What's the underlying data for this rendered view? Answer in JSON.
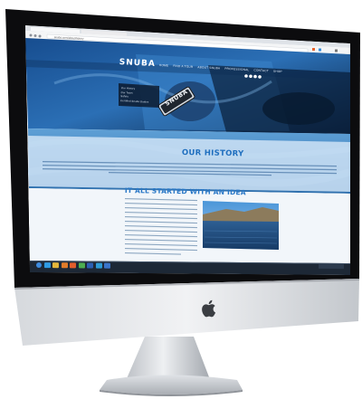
{
  "browser": {
    "url": "snuba.com/about/history",
    "tab_count": 3
  },
  "site": {
    "logo": "SNUBA",
    "nav": [
      "HOME",
      "FIND A TOUR",
      "ABOUT SNUBA",
      "PROFESSIONAL",
      "CONTACT",
      "SHOP"
    ],
    "hero_menu": [
      "Our History",
      "Our Team",
      "Safety",
      "Certified Snuba Guides"
    ],
    "hero_badge": "SNUBA",
    "history_heading": "OUR HISTORY",
    "idea_heading": "IT ALL STARTED WITH AN IDEA"
  },
  "taskbar": {
    "time": "",
    "icons": [
      "start-icon",
      "ie-icon",
      "folder-icon",
      "media-icon",
      "firefox-icon",
      "chrome-icon",
      "word-icon",
      "photoshop-icon",
      "outlook-icon"
    ]
  },
  "device": {
    "brand_logo": "apple-logo-icon"
  },
  "colors": {
    "site_blue": "#1f6fbf",
    "hero_dark": "#0d2f5a",
    "water": "#3c88c9",
    "taskbar": "#1d2836"
  }
}
